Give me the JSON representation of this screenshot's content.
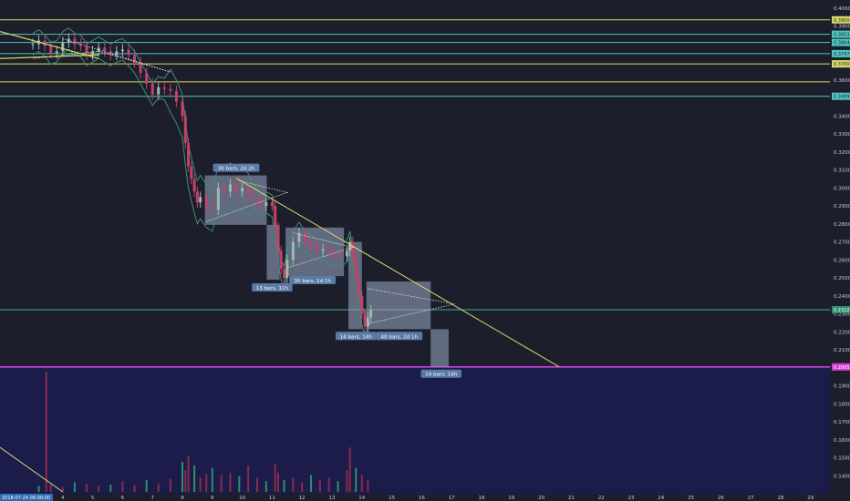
{
  "chart_data": {
    "type": "candlestick",
    "y_axis": {
      "range": [
        0.13,
        0.402
      ],
      "ticks": [
        "0.40000",
        "0.39000",
        "0.38000",
        "0.37000",
        "0.36000",
        "0.35000",
        "0.34000",
        "0.33000",
        "0.32000",
        "0.31000",
        "0.30000",
        "0.29000",
        "0.28000",
        "0.27000",
        "0.26000",
        "0.25000",
        "0.24000",
        "0.23000",
        "0.22000",
        "0.21000",
        "0.20000",
        "0.19000",
        "0.18000",
        "0.17000",
        "0.16000",
        "0.15000",
        "0.14000"
      ]
    },
    "x_axis": {
      "start_label": "2018-07-24 06:00:00",
      "labels": [
        "4",
        "5",
        "6",
        "7",
        "8",
        "9",
        "10",
        "11",
        "12",
        "13",
        "14",
        "15",
        "16",
        "17",
        "18",
        "19",
        "20",
        "21",
        "22",
        "23",
        "24",
        "25",
        "26",
        "27",
        "28",
        "29"
      ]
    },
    "price_series": {
      "x_days": [
        3.0,
        3.2,
        3.4,
        3.6,
        3.8,
        4.0,
        4.2,
        4.4,
        4.6,
        4.8,
        5.0,
        5.2,
        5.4,
        5.6,
        5.8,
        6.0,
        6.2,
        6.4,
        6.6,
        6.8,
        7.0,
        7.2,
        7.4,
        7.6,
        7.8,
        8.0,
        8.1,
        8.2,
        8.3,
        8.4,
        8.5,
        8.6,
        8.8,
        9.0,
        9.2,
        9.4,
        9.6,
        9.8,
        10.0,
        10.2,
        10.4,
        10.6,
        10.8,
        11.0,
        11.1,
        11.2,
        11.3,
        11.4,
        11.5,
        11.7,
        11.9,
        12.1,
        12.3,
        12.5,
        12.7,
        12.9,
        13.1,
        13.3,
        13.5,
        13.6,
        13.7,
        13.8,
        13.9,
        14.0,
        14.1,
        14.2,
        14.3
      ],
      "close": [
        0.38,
        0.382,
        0.379,
        0.375,
        0.376,
        0.381,
        0.383,
        0.38,
        0.379,
        0.374,
        0.376,
        0.378,
        0.376,
        0.374,
        0.376,
        0.377,
        0.374,
        0.37,
        0.364,
        0.358,
        0.352,
        0.356,
        0.355,
        0.354,
        0.348,
        0.34,
        0.325,
        0.312,
        0.305,
        0.298,
        0.292,
        0.295,
        0.29,
        0.288,
        0.3,
        0.298,
        0.302,
        0.298,
        0.3,
        0.296,
        0.295,
        0.29,
        0.292,
        0.29,
        0.278,
        0.265,
        0.255,
        0.25,
        0.26,
        0.27,
        0.275,
        0.27,
        0.268,
        0.265,
        0.266,
        0.264,
        0.263,
        0.262,
        0.265,
        0.27,
        0.26,
        0.25,
        0.24,
        0.23,
        0.223,
        0.228,
        0.232
      ]
    },
    "horizontal_levels": [
      {
        "value": 0.3935,
        "color": "#d9d96a"
      },
      {
        "value": 0.3855,
        "color": "#4fc6c0"
      },
      {
        "value": 0.3809,
        "color": "#4fc6c0"
      },
      {
        "value": 0.3747,
        "color": "#4fc6c0"
      },
      {
        "value": 0.369,
        "color": "#d9d96a"
      },
      {
        "value": 0.359,
        "color": "#d9d96a"
      },
      {
        "value": 0.351,
        "color": "#4fc6c0"
      },
      {
        "value": 0.2323,
        "color": "#4aa59a"
      },
      {
        "value": 0.2005,
        "color": "#d13fd1"
      }
    ],
    "price_tags": [
      {
        "label": "0.39000",
        "value": 0.3935,
        "bg": "#d9d96a",
        "fg": "#1c1f2b"
      },
      {
        "label": "0.38535",
        "value": 0.3855,
        "bg": "#4fc6c0",
        "fg": "#1c1f2b"
      },
      {
        "label": "0.38044",
        "value": 0.3809,
        "bg": "#4fc6c0",
        "fg": "#1c1f2b"
      },
      {
        "label": "0.37470",
        "value": 0.3747,
        "bg": "#4fc6c0",
        "fg": "#1c1f2b"
      },
      {
        "label": "0.37000",
        "value": 0.369,
        "bg": "#d9d96a",
        "fg": "#1c1f2b"
      },
      {
        "label": "0.34993",
        "value": 0.351,
        "bg": "#4fc6c0",
        "fg": "#1c1f2b"
      },
      {
        "label": "0.23229",
        "value": 0.2323,
        "bg": "#2e8e6e",
        "fg": "#ffffff"
      },
      {
        "label": "0.20053",
        "value": 0.2005,
        "bg": "#d13fd1",
        "fg": "#ffffff"
      }
    ],
    "boxes": [
      {
        "x0": 8.75,
        "x1": 10.82,
        "y0": 0.2795,
        "y1": 0.307
      },
      {
        "x0": 10.82,
        "x1": 11.25,
        "y0": 0.249,
        "y1": 0.2795
      },
      {
        "x0": 11.45,
        "x1": 13.4,
        "y0": 0.251,
        "y1": 0.278
      },
      {
        "x0": 13.55,
        "x1": 14.0,
        "y0": 0.2215,
        "y1": 0.27
      },
      {
        "x0": 14.15,
        "x1": 16.3,
        "y0": 0.2215,
        "y1": 0.248
      },
      {
        "x0": 16.3,
        "x1": 16.9,
        "y0": 0.2005,
        "y1": 0.2215
      }
    ],
    "annotations": [
      {
        "text": "30 bars, 2d 2h",
        "x": 9.8,
        "y": 0.311
      },
      {
        "text": "13 bars, 11h",
        "x": 11.0,
        "y": 0.2445
      },
      {
        "text": "30 bars, 2d 2h",
        "x": 12.35,
        "y": 0.2485
      },
      {
        "text": "14 bars, 14h",
        "x": 13.8,
        "y": 0.2175
      },
      {
        "text": "40 bars, 2d 1h",
        "x": 15.25,
        "y": 0.2175
      },
      {
        "text": "14 bars, 14h",
        "x": 16.65,
        "y": 0.1965
      }
    ],
    "volume": {
      "x_days": [
        3.2,
        3.6,
        4.0,
        4.4,
        4.8,
        5.2,
        5.6,
        6.0,
        6.4,
        6.8,
        7.2,
        7.6,
        8.0,
        8.1,
        8.2,
        8.4,
        8.6,
        8.8,
        9.0,
        9.3,
        9.6,
        9.9,
        10.2,
        10.5,
        10.8,
        11.1,
        11.2,
        11.4,
        11.7,
        12.0,
        12.3,
        12.6,
        12.9,
        13.2,
        13.5,
        13.6,
        13.8,
        14.0,
        14.2
      ],
      "values": [
        0.05,
        0.06,
        0.04,
        0.08,
        0.07,
        0.05,
        0.06,
        0.09,
        0.06,
        0.1,
        0.07,
        0.11,
        0.25,
        0.18,
        0.3,
        0.22,
        0.12,
        0.15,
        0.2,
        0.14,
        0.16,
        0.13,
        0.22,
        0.12,
        0.09,
        0.23,
        0.16,
        0.1,
        0.12,
        0.08,
        0.14,
        0.1,
        0.12,
        0.09,
        0.18,
        0.37,
        0.2,
        0.14,
        0.1
      ],
      "spike": {
        "x": 3.45,
        "value": 1.0
      }
    }
  }
}
